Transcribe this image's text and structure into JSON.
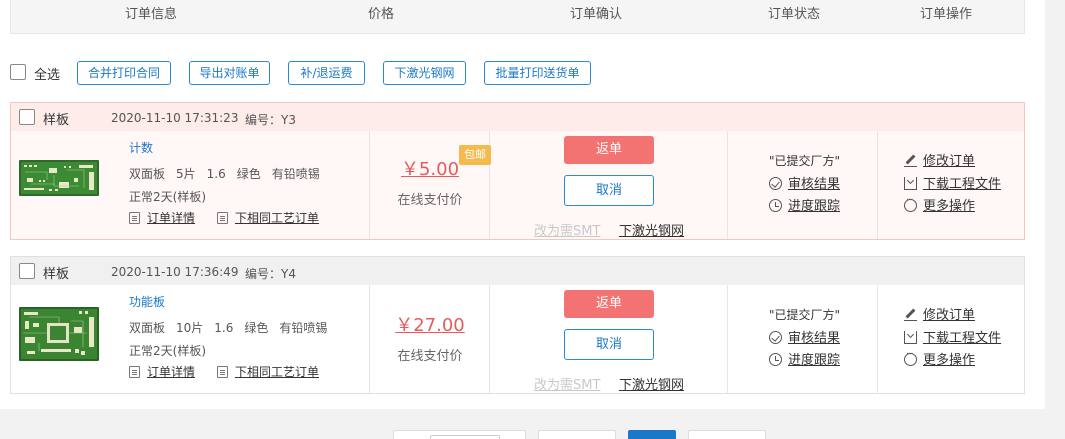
{
  "header": {
    "columns": [
      "订单信息",
      "价格",
      "订单确认",
      "订单状态",
      "订单操作"
    ]
  },
  "toolbar": {
    "select_all": "全选",
    "buttons": [
      "合并打印合同",
      "导出对账单",
      "补/退运费",
      "下激光钢网",
      "批量打印送货单"
    ]
  },
  "orders": [
    {
      "type": "样板",
      "time": "2020-11-10 17:31:23",
      "serial": "编号：Y3",
      "product_name": "计数",
      "spec": [
        "双面板",
        "5片",
        "1.6",
        "绿色",
        "有铅喷锡"
      ],
      "delivery": "正常2天(样板)",
      "detail_link": "订单详情",
      "same_link": "下相同工艺订单",
      "price": "￥5.00",
      "price_label": "在线支付价",
      "badge": "包邮",
      "return_btn": "返单",
      "cancel_btn": "取消",
      "smt_link": "改为需SMT",
      "steel_link": "下激光钢网",
      "status_text": "\"已提交厂方\"",
      "review_link": "审核结果",
      "track_link": "进度跟踪",
      "op_edit": "修改订单",
      "op_download": "下载工程文件",
      "op_more": "更多操作"
    },
    {
      "type": "样板",
      "time": "2020-11-10 17:36:49",
      "serial": "编号：Y4",
      "product_name": "功能板",
      "spec": [
        "双面板",
        "10片",
        "1.6",
        "绿色",
        "有铅喷锡"
      ],
      "delivery": "正常2天(样板)",
      "detail_link": "订单详情",
      "same_link": "下相同工艺订单",
      "price": "￥27.00",
      "price_label": "在线支付价",
      "return_btn": "返单",
      "cancel_btn": "取消",
      "smt_link": "改为需SMT",
      "steel_link": "下激光钢网",
      "status_text": "\"已提交厂方\"",
      "review_link": "审核结果",
      "track_link": "进度跟踪",
      "op_edit": "修改订单",
      "op_download": "下载工程文件",
      "op_more": "更多操作"
    }
  ],
  "colors": {
    "accent_blue": "#1a78c8",
    "return_red": "#f37272",
    "price_red": "#e85b5b",
    "badge_orange": "#f6b94d",
    "pcb_green": "#2e7d32"
  }
}
